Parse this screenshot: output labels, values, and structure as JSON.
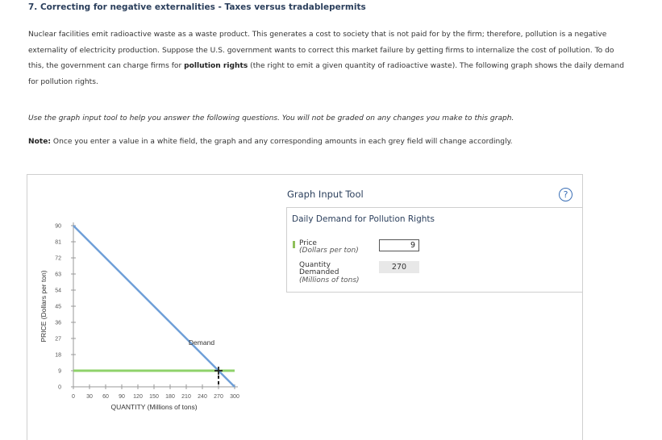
{
  "heading": "7. Correcting for negative externalities - Taxes versus tradablepermits",
  "paragraph": {
    "part1": "Nuclear facilities emit radioactive waste as a waste product. This generates a cost to society that is not paid for by the firm; therefore, pollution is a negative externality of electricity production. Suppose the U.S. government wants to correct this market failure by getting firms to internalize the cost of pollution. To do this, the government can charge firms for ",
    "bold": "pollution rights",
    "part2": " (the right to emit a given quantity of radioactive waste). The following graph shows the daily demand for pollution rights."
  },
  "instruction": "Use the graph input tool to help you answer the following questions. You will not be graded on any changes you make to this graph.",
  "note": {
    "label": "Note:",
    "text": " Once you enter a value in a white field, the graph and any corresponding amounts in each grey field will change accordingly."
  },
  "graph_input_tool": {
    "title": "Graph Input Tool",
    "help_icon": "?",
    "subtitle": "Daily Demand for Pollution Rights",
    "price_label": "Price",
    "price_unit": "(Dollars per ton)",
    "price_value": "9",
    "quantity_label_line1": "Quantity",
    "quantity_label_line2": "Demanded",
    "quantity_unit": "(Millions of tons)",
    "quantity_value": "270"
  },
  "colors": {
    "demand_line": "#6f9fd8",
    "price_line": "#8fd26a",
    "heading": "#2b3f5c",
    "help_icon": "#3b6fb6"
  },
  "chart_data": {
    "type": "line",
    "xlabel": "QUANTITY (Millions of tons)",
    "ylabel": "PRICE (Dollars per ton)",
    "xlim": [
      0,
      300
    ],
    "ylim": [
      0,
      90
    ],
    "xticks": [
      0,
      30,
      60,
      90,
      120,
      150,
      180,
      210,
      240,
      270,
      300
    ],
    "yticks": [
      0,
      9,
      18,
      27,
      36,
      45,
      54,
      63,
      72,
      81,
      90
    ],
    "grid": false,
    "series": [
      {
        "name": "Demand",
        "points": [
          [
            0,
            90
          ],
          [
            300,
            0
          ]
        ]
      }
    ],
    "price_line": {
      "y": 9
    },
    "marker": {
      "x": 270,
      "y": 9
    }
  }
}
